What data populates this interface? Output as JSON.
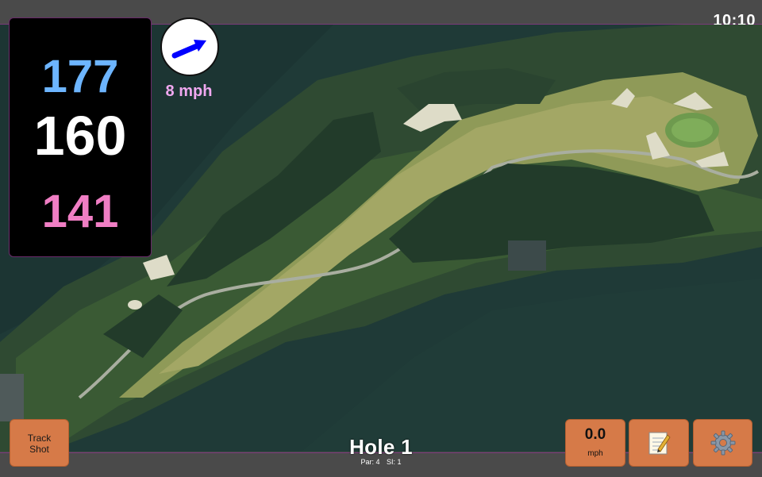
{
  "status": {
    "time": "10:10"
  },
  "distances": {
    "back": "177",
    "middle": "160",
    "front": "141"
  },
  "wind": {
    "speed": "8 mph",
    "direction_icon": "arrow-up-right-icon",
    "color": "#0000ff"
  },
  "hole": {
    "title": "Hole 1",
    "par_label": "Par: 4",
    "si_label": "SI: 1"
  },
  "buttons": {
    "track_shot_line1": "Track",
    "track_shot_line2": "Shot",
    "speed_value": "0.0",
    "speed_unit": "mph",
    "notes_icon": "notepad-icon",
    "settings_icon": "gear-icon"
  },
  "colors": {
    "back_distance": "#6db5ff",
    "middle_distance": "#ffffff",
    "front_distance": "#f07ec4",
    "button": "#d67a48",
    "wind_label": "#f0a8f0"
  }
}
